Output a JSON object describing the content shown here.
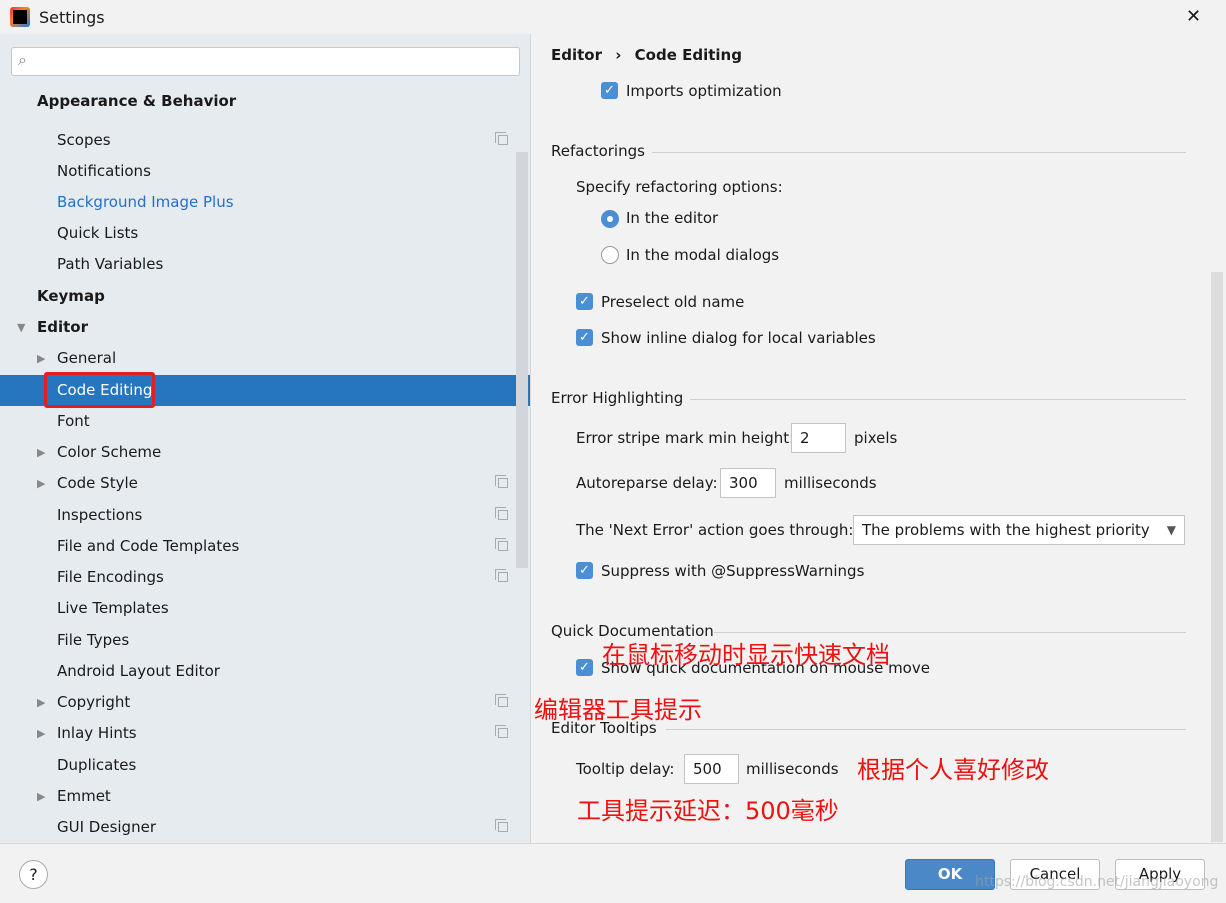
{
  "window": {
    "title": "Settings",
    "close": "✕"
  },
  "search": {
    "placeholder": ""
  },
  "sidebar": {
    "items": [
      {
        "label": "Appearance & Behavior",
        "bold": true,
        "indent": 0
      },
      {
        "label": "Scopes",
        "indent": 2,
        "copy": true
      },
      {
        "label": "Notifications",
        "indent": 2
      },
      {
        "label": "Background Image Plus",
        "indent": 2,
        "link": true
      },
      {
        "label": "Quick Lists",
        "indent": 2
      },
      {
        "label": "Path Variables",
        "indent": 2
      },
      {
        "label": "Keymap",
        "bold": true,
        "indent": 0
      },
      {
        "label": "Editor",
        "bold": true,
        "indent": 0,
        "arrow": "▼"
      },
      {
        "label": "General",
        "indent": 2,
        "arrow": "▶"
      },
      {
        "label": "Code Editing",
        "indent": 2,
        "selected": true
      },
      {
        "label": "Font",
        "indent": 2
      },
      {
        "label": "Color Scheme",
        "indent": 2,
        "arrow": "▶"
      },
      {
        "label": "Code Style",
        "indent": 2,
        "arrow": "▶",
        "copy": true
      },
      {
        "label": "Inspections",
        "indent": 2,
        "copy": true
      },
      {
        "label": "File and Code Templates",
        "indent": 2,
        "copy": true
      },
      {
        "label": "File Encodings",
        "indent": 2,
        "copy": true
      },
      {
        "label": "Live Templates",
        "indent": 2
      },
      {
        "label": "File Types",
        "indent": 2
      },
      {
        "label": "Android Layout Editor",
        "indent": 2
      },
      {
        "label": "Copyright",
        "indent": 2,
        "arrow": "▶",
        "copy": true
      },
      {
        "label": "Inlay Hints",
        "indent": 2,
        "arrow": "▶",
        "copy": true
      },
      {
        "label": "Duplicates",
        "indent": 2
      },
      {
        "label": "Emmet",
        "indent": 2,
        "arrow": "▶"
      },
      {
        "label": "GUI Designer",
        "indent": 2,
        "copy": true
      }
    ]
  },
  "breadcrumb": {
    "parent": "Editor",
    "sep": "›",
    "current": "Code Editing"
  },
  "main": {
    "imports_optimization": "Imports optimization",
    "refactorings": {
      "title": "Refactorings",
      "specify": "Specify refactoring options:",
      "in_editor": "In the editor",
      "in_modal": "In the modal dialogs",
      "selected": "In the editor",
      "preselect": "Preselect old name",
      "inline_dialog": "Show inline dialog for local variables"
    },
    "error": {
      "title": "Error Highlighting",
      "stripe_label": "Error stripe mark min height:",
      "stripe_value": "2",
      "stripe_unit": "pixels",
      "autoreparse_label": "Autoreparse delay:",
      "autoreparse_value": "300",
      "autoreparse_unit": "milliseconds",
      "next_error_label": "The 'Next Error' action goes through:",
      "next_error_value": "The problems with the highest priority",
      "suppress": "Suppress with @SuppressWarnings"
    },
    "quickdoc": {
      "title": "Quick Documentation",
      "show": "Show quick documentation on mouse move"
    },
    "tooltips": {
      "title": "Editor Tooltips",
      "delay_label": "Tooltip delay:",
      "delay_value": "500",
      "delay_unit": "milliseconds"
    }
  },
  "annotations": {
    "quickdoc": "在鼠标移动时显示快速文档",
    "tooltips": "编辑器工具提示",
    "preference": "根据个人喜好修改",
    "delay": "工具提示延迟：500毫秒"
  },
  "footer": {
    "help": "?",
    "ok": "OK",
    "cancel": "Cancel",
    "apply": "Apply"
  },
  "watermark": "https://blog.csdn.net/jiangjiaoyong",
  "colors": {
    "accent": "#2675bf",
    "annotation": "#f01010",
    "highlight_box": "#e02020"
  }
}
